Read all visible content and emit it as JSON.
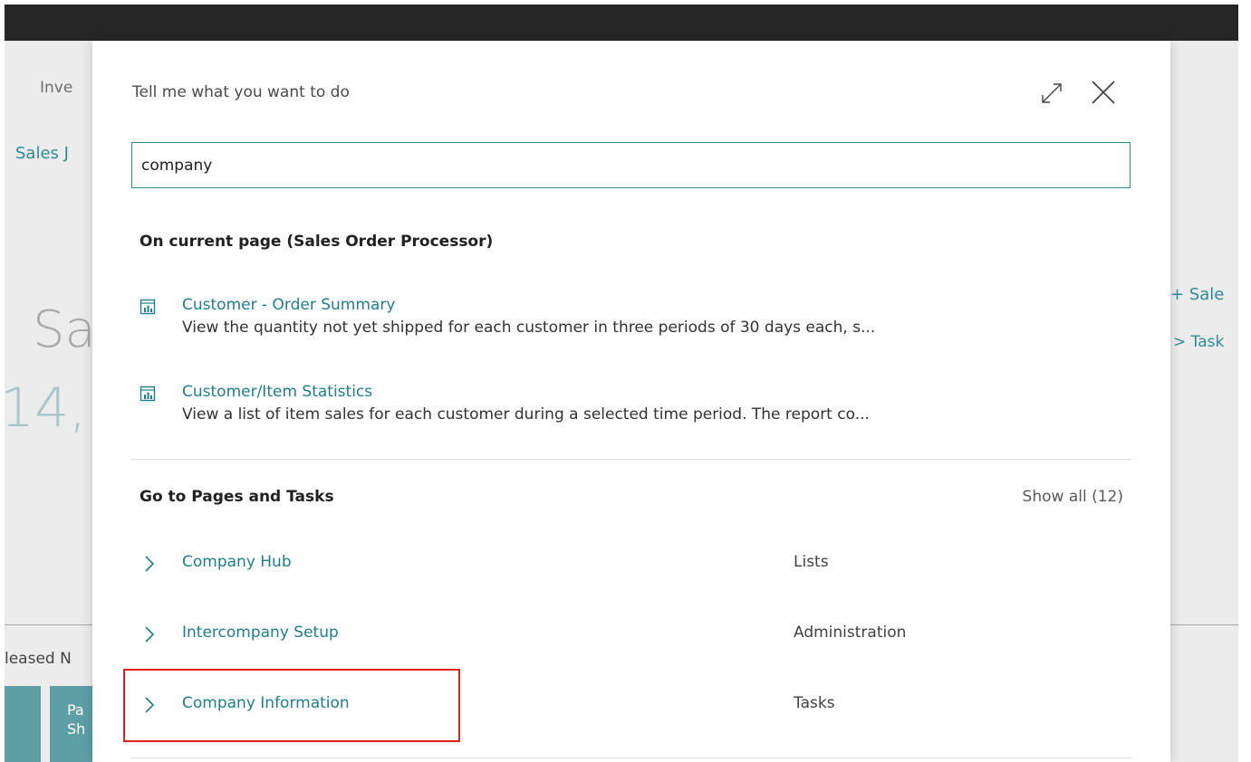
{
  "background": {
    "nav_fragment": "Inve",
    "link_fragment": "Sales J",
    "big_text_fragment": "Sa",
    "big_number_fragment": "14,",
    "released_fragment": "leased N",
    "tile_text_line1": "Pa",
    "tile_text_line2": "Sh",
    "right_action_1": "+ Sale",
    "right_action_2": "> Task"
  },
  "dialog": {
    "title": "Tell me what you want to do",
    "search": {
      "value": "company"
    },
    "current_page_section": {
      "heading": "On current page (Sales Order Processor)",
      "items": [
        {
          "title": "Customer - Order Summary",
          "description": "View the quantity not yet shipped for each customer in three periods of 30 days each, s...",
          "icon": "report-icon"
        },
        {
          "title": "Customer/Item Statistics",
          "description": "View a list of item sales for each customer during a selected time period. The report co...",
          "icon": "report-icon"
        }
      ]
    },
    "pages_section": {
      "heading": "Go to Pages and Tasks",
      "show_all": "Show all (12)",
      "items": [
        {
          "label": "Company Hub",
          "category": "Lists"
        },
        {
          "label": "Intercompany Setup",
          "category": "Administration"
        },
        {
          "label": "Company Information",
          "category": "Tasks",
          "highlighted": true
        }
      ]
    }
  },
  "colors": {
    "accent": "#1f7e87",
    "highlight": "#e0201c",
    "topbar": "#262626"
  }
}
